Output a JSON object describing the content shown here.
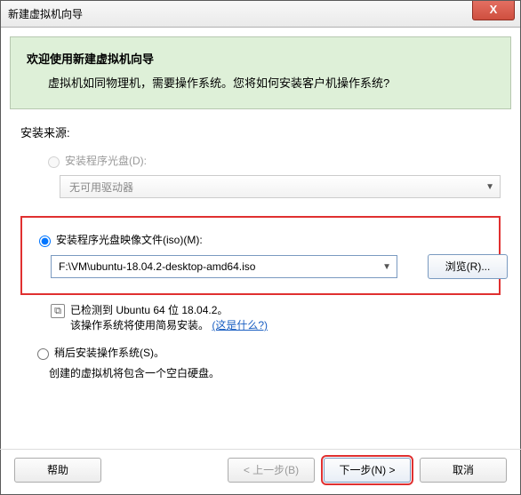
{
  "window": {
    "title": "新建虚拟机向导",
    "close": "X"
  },
  "header": {
    "title": "欢迎使用新建虚拟机向导",
    "subtitle": "虚拟机如同物理机，需要操作系统。您将如何安装客户机操作系统?"
  },
  "source_label": "安装来源:",
  "option_disc": {
    "label": "安装程序光盘(D):",
    "dropdown": "无可用驱动器"
  },
  "option_iso": {
    "label": "安装程序光盘映像文件(iso)(M):",
    "path": "F:\\VM\\ubuntu-18.04.2-desktop-amd64.iso",
    "browse": "浏览(R)...",
    "detected": "已检测到 Ubuntu 64 位 18.04.2。",
    "easy_install": "该操作系统将使用简易安装。",
    "whats_this": "(这是什么?)"
  },
  "option_later": {
    "label": "稍后安装操作系统(S)。",
    "desc": "创建的虚拟机将包含一个空白硬盘。"
  },
  "footer": {
    "help": "帮助",
    "back": "< 上一步(B)",
    "next": "下一步(N) >",
    "cancel": "取消"
  }
}
